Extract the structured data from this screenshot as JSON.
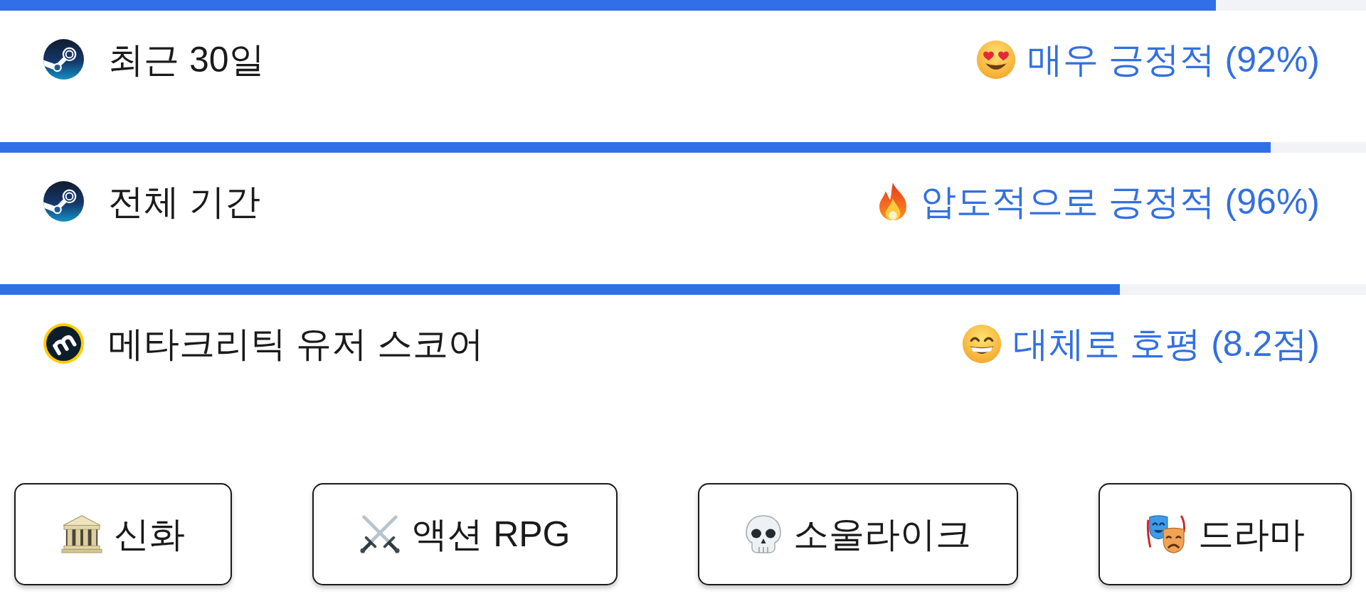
{
  "ratings": [
    {
      "kind": "steam",
      "label": "최근 30일",
      "level": 0.89,
      "verdict": "매우 긍정적 (92%)"
    },
    {
      "kind": "steam",
      "label": "전체 기간",
      "level": 0.93,
      "verdict": "압도적으로 긍정적 (96%)"
    },
    {
      "kind": "metacritic",
      "label": "메타크리틱 유저 스코어",
      "level": 0.82,
      "verdict": "대체로 호평 (8.2점)"
    }
  ],
  "tags": [
    "신화",
    "액션 RPG",
    "소울라이크",
    "드라마"
  ]
}
